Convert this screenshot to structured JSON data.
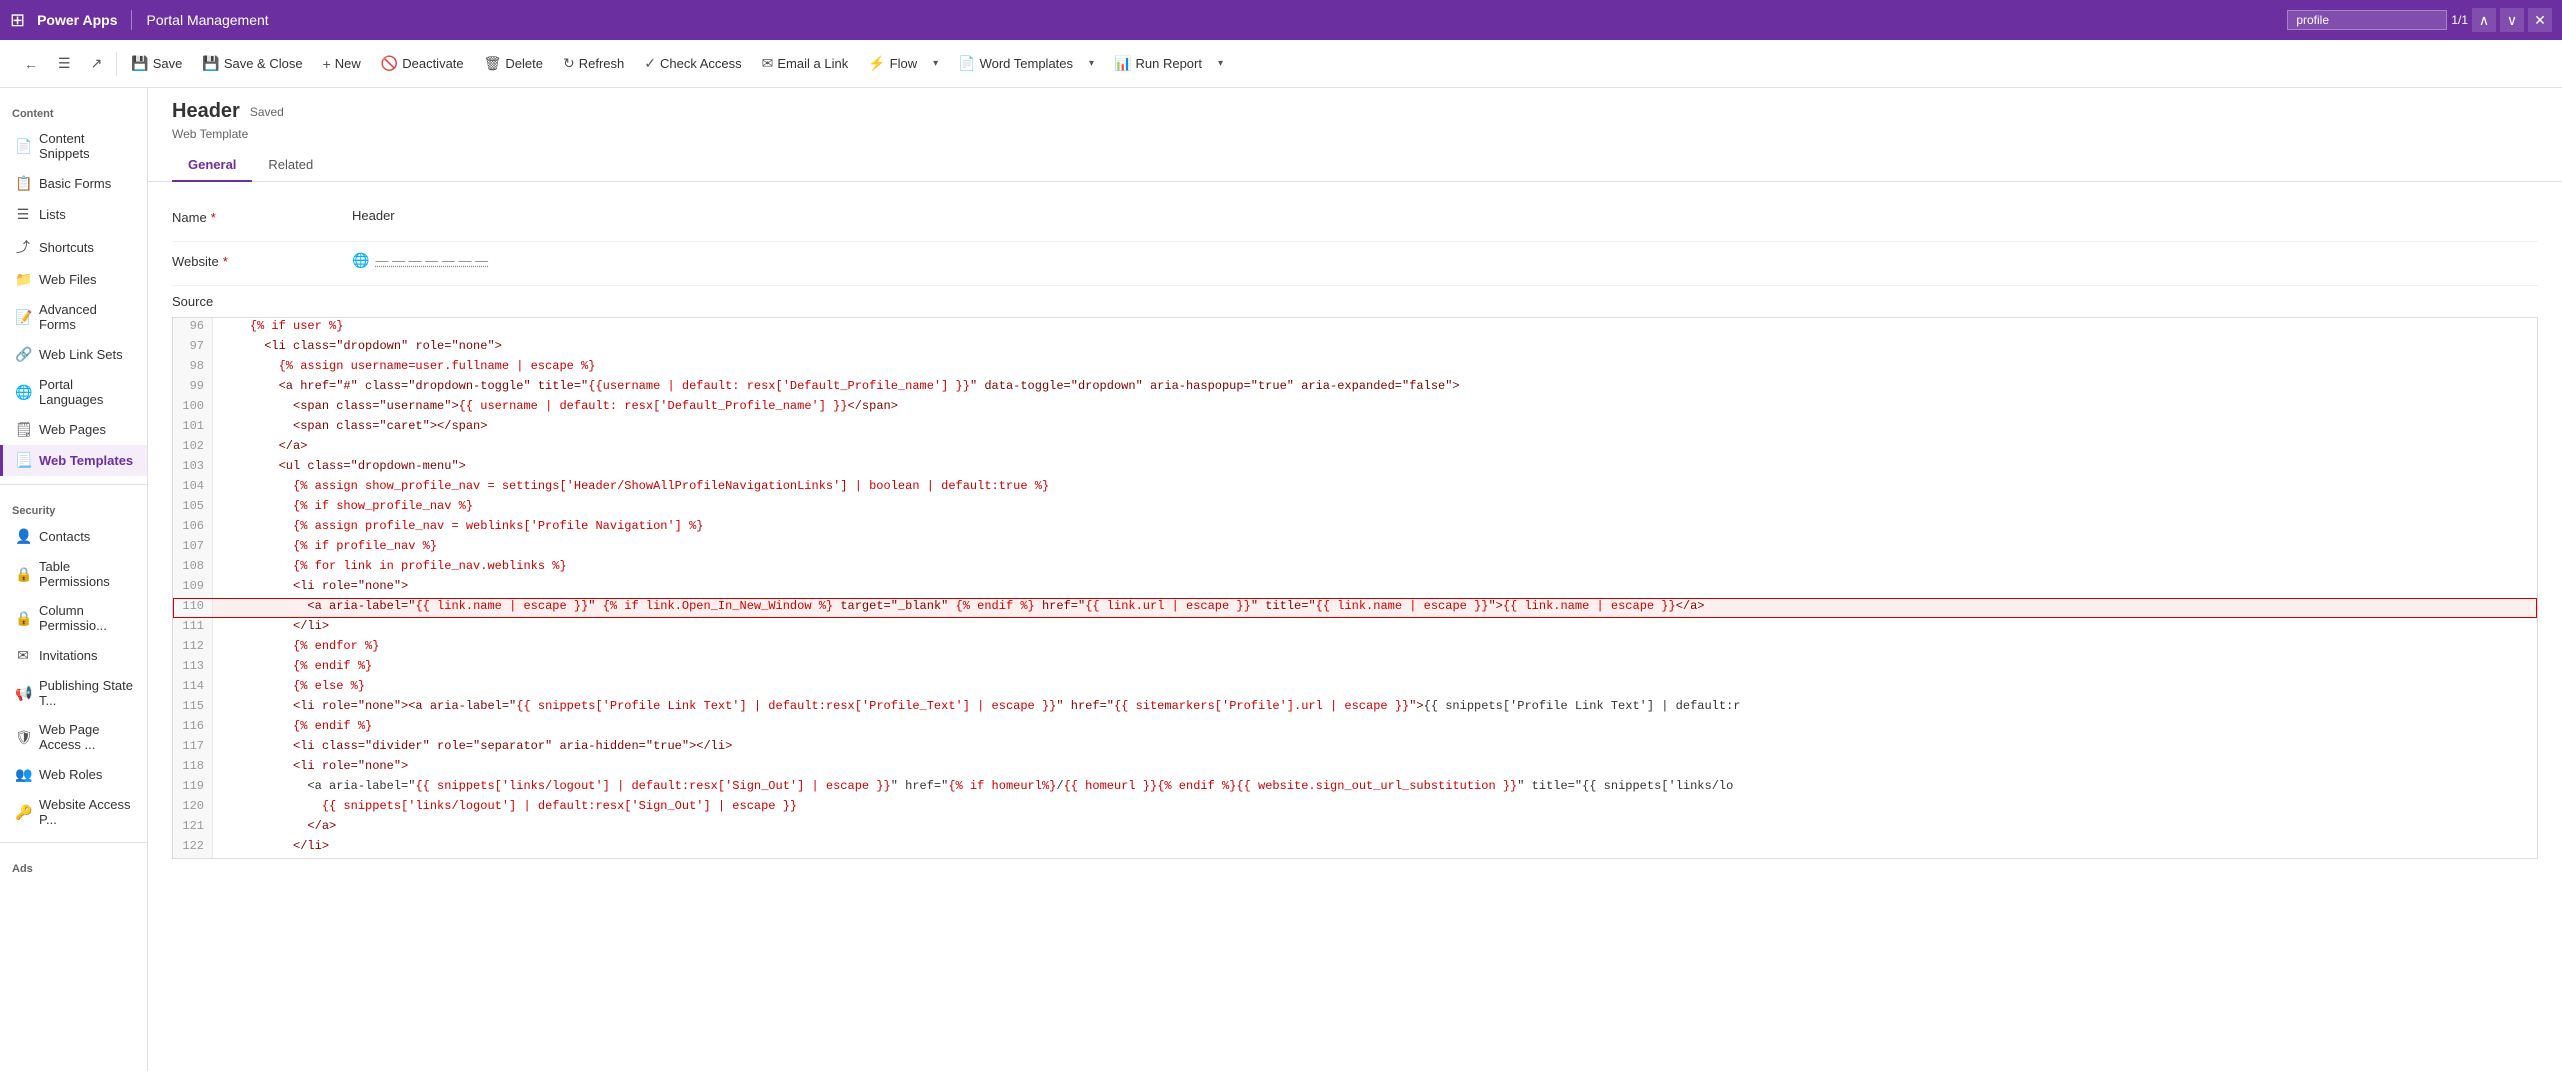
{
  "topbar": {
    "app_name": "Power Apps",
    "section_name": "Portal Management",
    "search_value": "profile",
    "match_text": "1/1"
  },
  "commandbar": {
    "back_label": "←",
    "save_label": "Save",
    "save_close_label": "Save & Close",
    "new_label": "New",
    "deactivate_label": "Deactivate",
    "delete_label": "Delete",
    "refresh_label": "Refresh",
    "check_access_label": "Check Access",
    "email_link_label": "Email a Link",
    "flow_label": "Flow",
    "word_templates_label": "Word Templates",
    "run_report_label": "Run Report"
  },
  "record": {
    "title": "Header",
    "saved_badge": "Saved",
    "type": "Web Template"
  },
  "tabs": [
    {
      "id": "general",
      "label": "General",
      "active": true
    },
    {
      "id": "related",
      "label": "Related",
      "active": false
    }
  ],
  "form": {
    "name_label": "Name",
    "name_value": "Header",
    "website_label": "Website",
    "website_placeholder": "--- ---",
    "source_label": "Source"
  },
  "sidebar": {
    "content_section": "Content",
    "items_content": [
      {
        "id": "content-snippets",
        "label": "Content Snippets",
        "icon": "📄",
        "active": false
      },
      {
        "id": "basic-forms",
        "label": "Basic Forms",
        "icon": "📋",
        "active": false
      },
      {
        "id": "lists",
        "label": "Lists",
        "icon": "☰",
        "active": false
      },
      {
        "id": "shortcuts",
        "label": "Shortcuts",
        "icon": "⤴",
        "active": false
      },
      {
        "id": "web-files",
        "label": "Web Files",
        "icon": "📁",
        "active": false
      },
      {
        "id": "advanced-forms",
        "label": "Advanced Forms",
        "icon": "📝",
        "active": false
      },
      {
        "id": "web-link-sets",
        "label": "Web Link Sets",
        "icon": "🔗",
        "active": false
      },
      {
        "id": "portal-languages",
        "label": "Portal Languages",
        "icon": "🌐",
        "active": false
      },
      {
        "id": "web-pages",
        "label": "Web Pages",
        "icon": "🗒",
        "active": false
      },
      {
        "id": "web-templates",
        "label": "Web Templates",
        "icon": "📃",
        "active": true
      }
    ],
    "security_section": "Security",
    "items_security": [
      {
        "id": "contacts",
        "label": "Contacts",
        "icon": "👤",
        "active": false
      },
      {
        "id": "table-permissions",
        "label": "Table Permissions",
        "icon": "🔒",
        "active": false
      },
      {
        "id": "column-permissions",
        "label": "Column Permissio...",
        "icon": "🔒",
        "active": false
      },
      {
        "id": "invitations",
        "label": "Invitations",
        "icon": "✉",
        "active": false
      },
      {
        "id": "publishing-state",
        "label": "Publishing State T...",
        "icon": "📢",
        "active": false
      },
      {
        "id": "web-page-access",
        "label": "Web Page Access ...",
        "icon": "🛡",
        "active": false
      },
      {
        "id": "web-roles",
        "label": "Web Roles",
        "icon": "👥",
        "active": false
      },
      {
        "id": "website-access",
        "label": "Website Access P...",
        "icon": "🔑",
        "active": false
      }
    ],
    "ads_section": "Ads"
  },
  "code_lines": [
    {
      "num": 96,
      "content": "    {% if user %}",
      "highlight": false
    },
    {
      "num": 97,
      "content": "      <li class=\"dropdown\" role=\"none\">",
      "highlight": false
    },
    {
      "num": 98,
      "content": "        {% assign username=user.fullname | escape %}",
      "highlight": false
    },
    {
      "num": 99,
      "content": "        <a href=\"#\" class=\"dropdown-toggle\" title=\"{{username | default: resx['Default_Profile_name'] }}\" data-toggle=\"dropdown\" aria-haspopup=\"true\" aria-expanded=\"false\">",
      "highlight": false
    },
    {
      "num": 100,
      "content": "          <span class=\"username\">{{ username | default: resx['Default_Profile_name'] }}</span>",
      "highlight": false
    },
    {
      "num": 101,
      "content": "          <span class=\"caret\"></span>",
      "highlight": false
    },
    {
      "num": 102,
      "content": "        </a>",
      "highlight": false
    },
    {
      "num": 103,
      "content": "        <ul class=\"dropdown-menu\">",
      "highlight": false
    },
    {
      "num": 104,
      "content": "          {% assign show_profile_nav = settings['Header/ShowAllProfileNavigationLinks'] | boolean | default:true %}",
      "highlight": false
    },
    {
      "num": 105,
      "content": "          {% if show_profile_nav %}",
      "highlight": false
    },
    {
      "num": 106,
      "content": "          {% assign profile_nav = weblinks['Profile Navigation'] %}",
      "highlight": false
    },
    {
      "num": 107,
      "content": "          {% if profile_nav %}",
      "highlight": false
    },
    {
      "num": 108,
      "content": "          {% for link in profile_nav.weblinks %}",
      "highlight": false
    },
    {
      "num": 109,
      "content": "          <li role=\"none\">",
      "highlight": false
    },
    {
      "num": 110,
      "content": "            <a aria-label=\"{{ link.name | escape }}\" {% if link.Open_In_New_Window %} target=\"_blank\" {% endif %} href=\"{{ link.url | escape }}\" title=\"{{ link.name | escape }}\">{{ link.name | escape }}</a>",
      "highlight": true
    },
    {
      "num": 111,
      "content": "          </li>",
      "highlight": false
    },
    {
      "num": 112,
      "content": "          {% endfor %}",
      "highlight": false
    },
    {
      "num": 113,
      "content": "          {% endif %}",
      "highlight": false
    },
    {
      "num": 114,
      "content": "          {% else %}",
      "highlight": false
    },
    {
      "num": 115,
      "content": "          <li role=\"none\"><a aria-label=\"{{ snippets['Profile Link Text'] | default:resx['Profile_Text'] | escape }}\" href=\"{{ sitemarkers['Profile'].url | escape }}\">{{ snippets['Profile Link Text'] | default:r",
      "highlight": false
    },
    {
      "num": 116,
      "content": "          {% endif %}",
      "highlight": false
    },
    {
      "num": 117,
      "content": "          <li class=\"divider\" role=\"separator\" aria-hidden=\"true\"></li>",
      "highlight": false
    },
    {
      "num": 118,
      "content": "          <li role=\"none\">",
      "highlight": false
    },
    {
      "num": 119,
      "content": "            <a aria-label=\"{{ snippets['links/logout'] | default:resx['Sign_Out'] | escape }}\" href=\"{% if homeurl%}/{{ homeurl }}{% endif %}{{ website.sign_out_url_substitution }}\" title=\"{{ snippets['links/lo",
      "highlight": false
    },
    {
      "num": 120,
      "content": "              {{ snippets['links/logout'] | default:resx['Sign_Out'] | escape }}",
      "highlight": false
    },
    {
      "num": 121,
      "content": "            </a>",
      "highlight": false
    },
    {
      "num": 122,
      "content": "          </li>",
      "highlight": false
    }
  ]
}
